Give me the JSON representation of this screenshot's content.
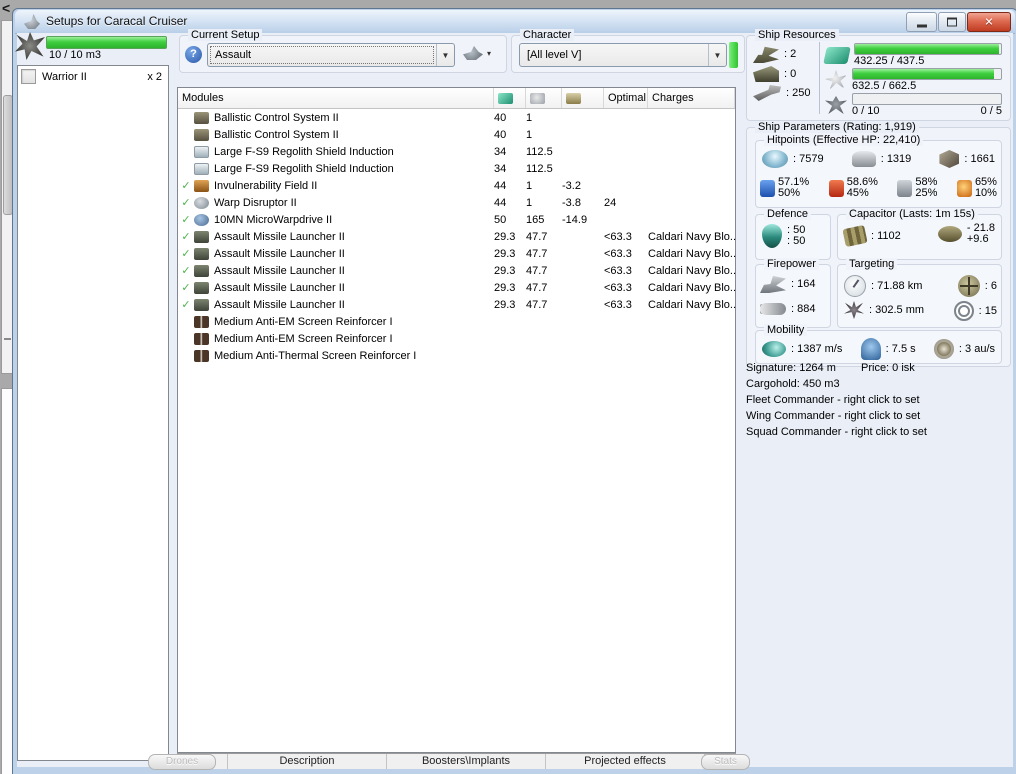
{
  "window": {
    "title": "Setups for Caracal Cruiser",
    "close_glyph": "✕"
  },
  "background_edge": {
    "collapse_chevron": "<"
  },
  "drone_bay": {
    "capacity_text": "10 / 10 m3",
    "items": [
      {
        "name": "Warrior II",
        "qty": "x 2"
      }
    ]
  },
  "current_setup": {
    "label": "Current Setup",
    "value": "Assault",
    "arrow": "▼",
    "caret": "▾",
    "help_glyph": "?"
  },
  "character": {
    "label": "Character",
    "value": "[All level V]",
    "arrow": "▼"
  },
  "modules_table": {
    "check_glyph": "✓",
    "header": {
      "name": "Modules",
      "optimal": "Optimal",
      "charges": "Charges"
    },
    "rows": [
      {
        "check": false,
        "icon": "bcs",
        "name": "Ballistic Control System II",
        "cpu": "40",
        "pg": "1",
        "cap": "",
        "optimal": "",
        "charges": ""
      },
      {
        "check": false,
        "icon": "bcs",
        "name": "Ballistic Control System II",
        "cpu": "40",
        "pg": "1",
        "cap": "",
        "optimal": "",
        "charges": ""
      },
      {
        "check": false,
        "icon": "shield-ext",
        "name": "Large F-S9 Regolith Shield Induction",
        "cpu": "34",
        "pg": "112.5",
        "cap": "",
        "optimal": "",
        "charges": ""
      },
      {
        "check": false,
        "icon": "shield-ext",
        "name": "Large F-S9 Regolith Shield Induction",
        "cpu": "34",
        "pg": "112.5",
        "cap": "",
        "optimal": "",
        "charges": ""
      },
      {
        "check": true,
        "icon": "invuln",
        "name": "Invulnerability Field II",
        "cpu": "44",
        "pg": "1",
        "cap": "-3.2",
        "optimal": "",
        "charges": ""
      },
      {
        "check": true,
        "icon": "disruptor",
        "name": "Warp Disruptor II",
        "cpu": "44",
        "pg": "1",
        "cap": "-3.8",
        "optimal": "24",
        "charges": ""
      },
      {
        "check": true,
        "icon": "mwd",
        "name": "10MN MicroWarpdrive II",
        "cpu": "50",
        "pg": "165",
        "cap": "-14.9",
        "optimal": "",
        "charges": ""
      },
      {
        "check": true,
        "icon": "launcher",
        "name": "Assault Missile Launcher II",
        "cpu": "29.3",
        "pg": "47.7",
        "cap": "",
        "optimal": "<63.3",
        "charges": "Caldari Navy Blo..."
      },
      {
        "check": true,
        "icon": "launcher",
        "name": "Assault Missile Launcher II",
        "cpu": "29.3",
        "pg": "47.7",
        "cap": "",
        "optimal": "<63.3",
        "charges": "Caldari Navy Blo..."
      },
      {
        "check": true,
        "icon": "launcher",
        "name": "Assault Missile Launcher II",
        "cpu": "29.3",
        "pg": "47.7",
        "cap": "",
        "optimal": "<63.3",
        "charges": "Caldari Navy Blo..."
      },
      {
        "check": true,
        "icon": "launcher",
        "name": "Assault Missile Launcher II",
        "cpu": "29.3",
        "pg": "47.7",
        "cap": "",
        "optimal": "<63.3",
        "charges": "Caldari Navy Blo..."
      },
      {
        "check": true,
        "icon": "launcher",
        "name": "Assault Missile Launcher II",
        "cpu": "29.3",
        "pg": "47.7",
        "cap": "",
        "optimal": "<63.3",
        "charges": "Caldari Navy Blo..."
      },
      {
        "check": false,
        "icon": "rig",
        "name": "Medium Anti-EM Screen Reinforcer I",
        "cpu": "",
        "pg": "",
        "cap": "",
        "optimal": "",
        "charges": ""
      },
      {
        "check": false,
        "icon": "rig",
        "name": "Medium Anti-EM Screen Reinforcer I",
        "cpu": "",
        "pg": "",
        "cap": "",
        "optimal": "",
        "charges": ""
      },
      {
        "check": false,
        "icon": "rig",
        "name": "Medium Anti-Thermal Screen Reinforcer I",
        "cpu": "",
        "pg": "",
        "cap": "",
        "optimal": "",
        "charges": ""
      }
    ]
  },
  "ship_resources": {
    "label": "Ship Resources",
    "turrets": ": 2",
    "launchers": ": 0",
    "calibration": ": 250",
    "cpu": {
      "text": "432.25 / 437.5",
      "pct": 98.8
    },
    "powergrid": {
      "text": "632.5 / 662.5",
      "pct": 95.5
    },
    "drones": {
      "left": "0 / 10",
      "right": "0 / 5",
      "pct": 0
    }
  },
  "ship_parameters": {
    "label": "Ship Parameters (Rating: 1,919)",
    "hitpoints": {
      "label": "Hitpoints (Effective HP: 22,410)",
      "shield": ": 7579",
      "armor": ": 1319",
      "structure": ": 1661",
      "resists": [
        {
          "type": "em",
          "top": "57.1%",
          "bottom": "50%"
        },
        {
          "type": "thermal",
          "top": "58.6%",
          "bottom": "45%"
        },
        {
          "type": "kinetic",
          "top": "58%",
          "bottom": "25%"
        },
        {
          "type": "explosive",
          "top": "65%",
          "bottom": "10%"
        }
      ]
    },
    "defence": {
      "label": "Defence",
      "line1": ": 50",
      "line2": ": 50"
    },
    "capacitor": {
      "label": "Capacitor (Lasts: 1m 15s)",
      "amount": ": 1102",
      "delta_top": "- 21.8",
      "delta_bottom": "+9.6"
    },
    "firepower": {
      "label": "Firepower",
      "dps": ": 164",
      "volley": ": 884"
    },
    "targeting": {
      "label": "Targeting",
      "range": ": 71.88 km",
      "max_targets": ": 6",
      "scan_res": ": 302.5 mm",
      "sensor_strength": ": 15"
    },
    "mobility": {
      "label": "Mobility",
      "speed": ": 1387 m/s",
      "align": ": 7.5 s",
      "warp": ": 3 au/s"
    }
  },
  "info": {
    "signature": "Signature: 1264 m",
    "price": "Price: 0 isk",
    "cargohold": "Cargohold: 450 m3",
    "fleet": "Fleet Commander - right click to set",
    "wing": "Wing Commander - right click to set",
    "squad": "Squad Commander - right click to set"
  },
  "bottom": {
    "drones_button": "Drones",
    "stats_button": "Stats",
    "tabs": [
      "Description",
      "Boosters\\Implants",
      "Projected effects"
    ]
  },
  "colors": {
    "accent_green": "#3ecf3e",
    "close_red": "#bf3c22",
    "check_green": "#4cb44c"
  }
}
